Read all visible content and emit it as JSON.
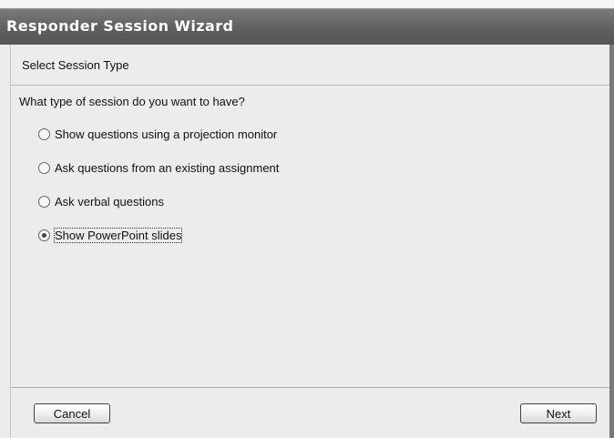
{
  "window": {
    "title": "Responder Session Wizard"
  },
  "step": {
    "title": "Select Session Type"
  },
  "question": "What type of session do you want to have?",
  "options": [
    {
      "label": "Show questions using a projection monitor",
      "selected": false
    },
    {
      "label": "Ask questions from an existing assignment",
      "selected": false
    },
    {
      "label": "Ask verbal questions",
      "selected": false
    },
    {
      "label": "Show PowerPoint slides",
      "selected": true
    }
  ],
  "buttons": {
    "cancel": "Cancel",
    "next": "Next"
  }
}
